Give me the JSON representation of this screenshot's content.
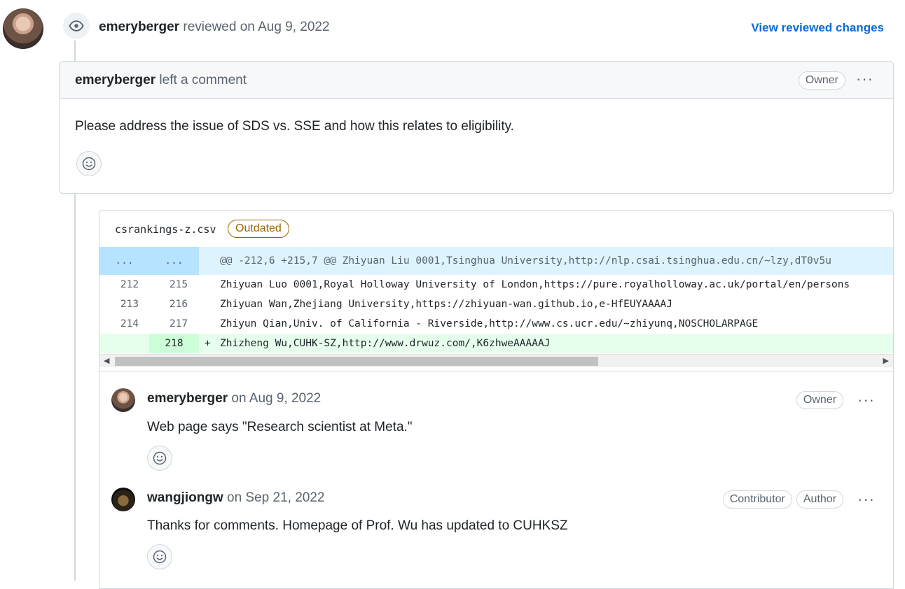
{
  "review": {
    "user": "emeryberger",
    "action": "reviewed on Aug 9, 2022",
    "view_changes": "View reviewed changes"
  },
  "comment": {
    "author": "emeryberger",
    "action": "left a comment",
    "badge": "Owner",
    "more": "···",
    "body": "Please address the issue of SDS vs. SSE and how this relates to eligibility."
  },
  "file": {
    "name": "csrankings-z.csv",
    "status": "Outdated"
  },
  "diff": {
    "hunk": {
      "left": "...",
      "right": "...",
      "text": "@@ -212,6 +215,7 @@ Zhiyuan Liu 0001,Tsinghua University,http://nlp.csai.tsinghua.edu.cn/~lzy,dT0v5u"
    },
    "rows": [
      {
        "left": "212",
        "right": "215",
        "marker": "",
        "text": "Zhiyuan Luo 0001,Royal Holloway University of London,https://pure.royalholloway.ac.uk/portal/en/persons"
      },
      {
        "left": "213",
        "right": "216",
        "marker": "",
        "text": "Zhiyuan Wan,Zhejiang University,https://zhiyuan-wan.github.io,e-HfEUYAAAAJ"
      },
      {
        "left": "214",
        "right": "217",
        "marker": "",
        "text": "Zhiyun Qian,Univ. of California - Riverside,http://www.cs.ucr.edu/~zhiyunq,NOSCHOLARPAGE"
      },
      {
        "left": "",
        "right": "218",
        "marker": "+",
        "text": "Zhizheng Wu,CUHK-SZ,http://www.drwuz.com/,K6zhweAAAAAJ"
      }
    ]
  },
  "replies": [
    {
      "author": "emeryberger",
      "date": "on Aug 9, 2022",
      "badges": [
        "Owner"
      ],
      "body": "Web page says \"Research scientist at Meta.\"",
      "more": "···"
    },
    {
      "author": "wangjiongw",
      "date": "on Sep 21, 2022",
      "badges": [
        "Contributor",
        "Author"
      ],
      "body": "Thanks for comments. Homepage of Prof. Wu has updated to CUHKSZ",
      "more": "···"
    }
  ],
  "colors": {
    "link": "#0969da",
    "outdated": "#9a6700",
    "hunk_bg": "#ddf4ff",
    "add_bg": "#e6ffec"
  },
  "icons": {
    "review": "eye-icon",
    "reaction": "smiley-icon",
    "more": "kebab-horizontal-icon"
  }
}
